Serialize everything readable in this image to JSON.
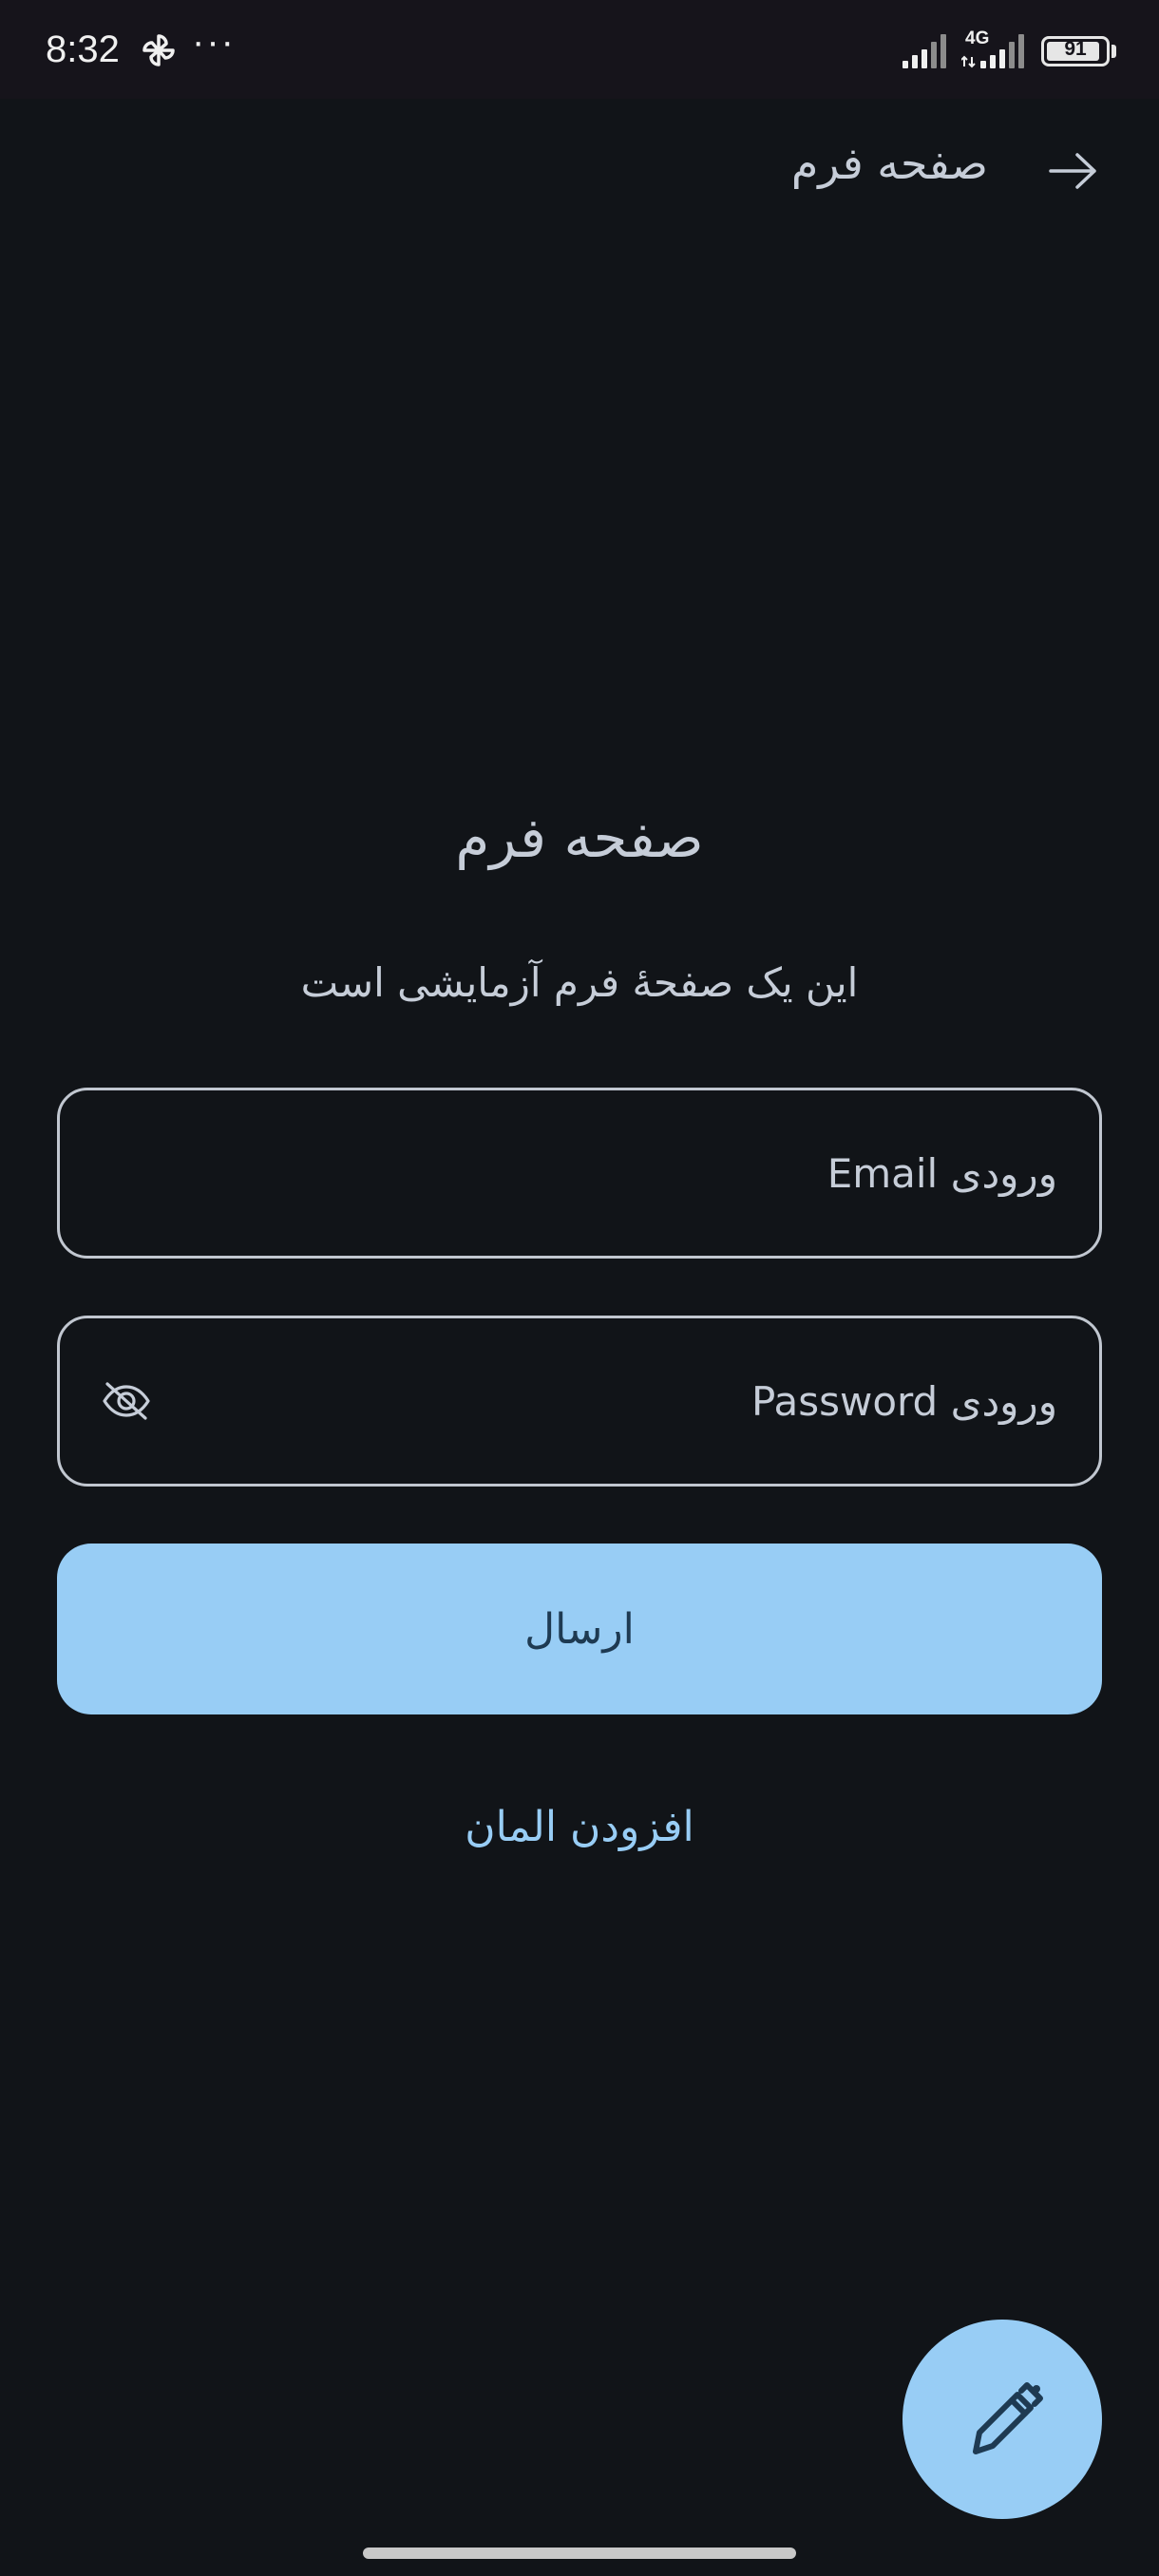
{
  "status_bar": {
    "time": "8:32",
    "more": "···",
    "network": "4G",
    "battery": "91",
    "battery_level": 0.91
  },
  "app_bar": {
    "title": "صفحه فرم",
    "back_icon": "arrow-right-icon"
  },
  "content": {
    "heading": "صفحه فرم",
    "subtitle": "این یک صفحهٔ فرم آزمایشی است",
    "email_placeholder": "ورودی Email",
    "password_placeholder": "ورودی Password",
    "password_toggle_icon": "eye-off-icon",
    "submit_label": "ارسال",
    "add_element_label": "افزودن المان"
  },
  "fab": {
    "icon": "pen-icon"
  },
  "colors": {
    "background": "#111418",
    "accent": "#98cdf5",
    "text": "#c6cdd8",
    "outline": "#c1c7d0"
  }
}
